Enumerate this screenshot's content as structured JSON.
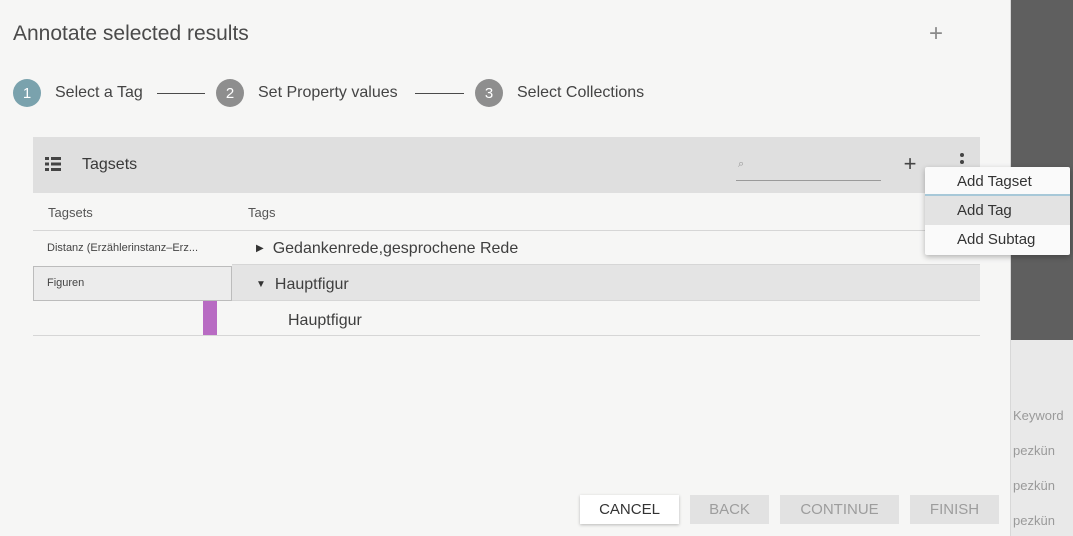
{
  "dialog": {
    "title": "Annotate selected results"
  },
  "stepper": {
    "steps": [
      {
        "number": "1",
        "label": "Select a Tag"
      },
      {
        "number": "2",
        "label": "Set Property values"
      },
      {
        "number": "3",
        "label": "Select Collections"
      }
    ]
  },
  "panel": {
    "title": "Tagsets",
    "search_value": "",
    "columns": {
      "tagsets": "Tagsets",
      "tags": "Tags"
    },
    "tagsets": [
      {
        "label": "Distanz (Erzählerinstanz–Erz..."
      },
      {
        "label": "Figuren"
      }
    ],
    "tags": [
      {
        "label": "Gedankenrede,gesprochene Rede"
      },
      {
        "label": "Hauptfigur"
      },
      {
        "label": "Hauptfigur"
      }
    ],
    "swatch_color": "#b86bc3"
  },
  "menu": {
    "items": [
      {
        "label": "Add Tagset"
      },
      {
        "label": "Add Tag"
      },
      {
        "label": "Add Subtag"
      }
    ]
  },
  "footer": {
    "cancel": "CANCEL",
    "back": "BACK",
    "continue": "CONTINUE",
    "finish": "FINISH"
  },
  "background": {
    "texts": [
      "Keyword",
      "pezkün",
      "pezkün",
      "pezkün"
    ]
  },
  "colors": {
    "step_active": "#7aa2ad",
    "step_inactive": "#8e8e8e",
    "menu_focus": "#a7c8d8"
  }
}
